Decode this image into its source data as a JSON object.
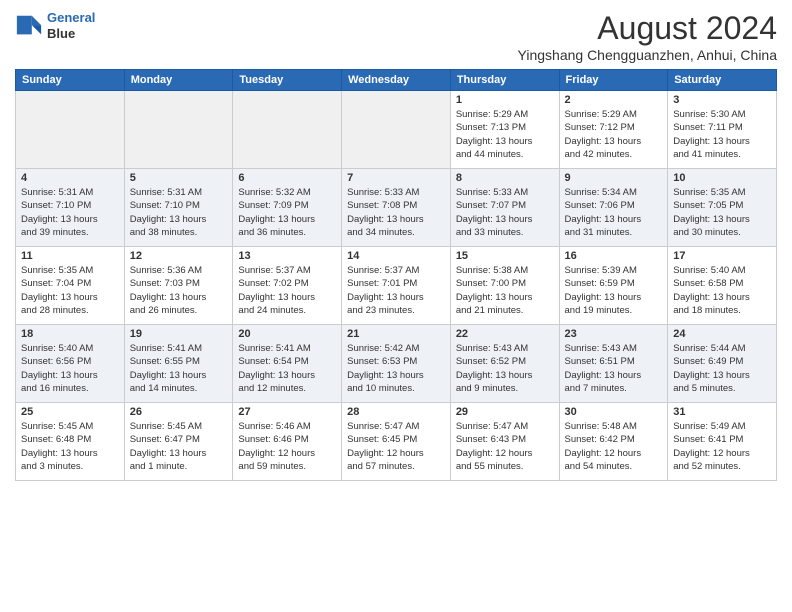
{
  "logo": {
    "line1": "General",
    "line2": "Blue"
  },
  "title": "August 2024",
  "subtitle": "Yingshang Chengguanzhen, Anhui, China",
  "weekdays": [
    "Sunday",
    "Monday",
    "Tuesday",
    "Wednesday",
    "Thursday",
    "Friday",
    "Saturday"
  ],
  "rows": [
    [
      {
        "day": "",
        "info": ""
      },
      {
        "day": "",
        "info": ""
      },
      {
        "day": "",
        "info": ""
      },
      {
        "day": "",
        "info": ""
      },
      {
        "day": "1",
        "info": "Sunrise: 5:29 AM\nSunset: 7:13 PM\nDaylight: 13 hours\nand 44 minutes."
      },
      {
        "day": "2",
        "info": "Sunrise: 5:29 AM\nSunset: 7:12 PM\nDaylight: 13 hours\nand 42 minutes."
      },
      {
        "day": "3",
        "info": "Sunrise: 5:30 AM\nSunset: 7:11 PM\nDaylight: 13 hours\nand 41 minutes."
      }
    ],
    [
      {
        "day": "4",
        "info": "Sunrise: 5:31 AM\nSunset: 7:10 PM\nDaylight: 13 hours\nand 39 minutes."
      },
      {
        "day": "5",
        "info": "Sunrise: 5:31 AM\nSunset: 7:10 PM\nDaylight: 13 hours\nand 38 minutes."
      },
      {
        "day": "6",
        "info": "Sunrise: 5:32 AM\nSunset: 7:09 PM\nDaylight: 13 hours\nand 36 minutes."
      },
      {
        "day": "7",
        "info": "Sunrise: 5:33 AM\nSunset: 7:08 PM\nDaylight: 13 hours\nand 34 minutes."
      },
      {
        "day": "8",
        "info": "Sunrise: 5:33 AM\nSunset: 7:07 PM\nDaylight: 13 hours\nand 33 minutes."
      },
      {
        "day": "9",
        "info": "Sunrise: 5:34 AM\nSunset: 7:06 PM\nDaylight: 13 hours\nand 31 minutes."
      },
      {
        "day": "10",
        "info": "Sunrise: 5:35 AM\nSunset: 7:05 PM\nDaylight: 13 hours\nand 30 minutes."
      }
    ],
    [
      {
        "day": "11",
        "info": "Sunrise: 5:35 AM\nSunset: 7:04 PM\nDaylight: 13 hours\nand 28 minutes."
      },
      {
        "day": "12",
        "info": "Sunrise: 5:36 AM\nSunset: 7:03 PM\nDaylight: 13 hours\nand 26 minutes."
      },
      {
        "day": "13",
        "info": "Sunrise: 5:37 AM\nSunset: 7:02 PM\nDaylight: 13 hours\nand 24 minutes."
      },
      {
        "day": "14",
        "info": "Sunrise: 5:37 AM\nSunset: 7:01 PM\nDaylight: 13 hours\nand 23 minutes."
      },
      {
        "day": "15",
        "info": "Sunrise: 5:38 AM\nSunset: 7:00 PM\nDaylight: 13 hours\nand 21 minutes."
      },
      {
        "day": "16",
        "info": "Sunrise: 5:39 AM\nSunset: 6:59 PM\nDaylight: 13 hours\nand 19 minutes."
      },
      {
        "day": "17",
        "info": "Sunrise: 5:40 AM\nSunset: 6:58 PM\nDaylight: 13 hours\nand 18 minutes."
      }
    ],
    [
      {
        "day": "18",
        "info": "Sunrise: 5:40 AM\nSunset: 6:56 PM\nDaylight: 13 hours\nand 16 minutes."
      },
      {
        "day": "19",
        "info": "Sunrise: 5:41 AM\nSunset: 6:55 PM\nDaylight: 13 hours\nand 14 minutes."
      },
      {
        "day": "20",
        "info": "Sunrise: 5:41 AM\nSunset: 6:54 PM\nDaylight: 13 hours\nand 12 minutes."
      },
      {
        "day": "21",
        "info": "Sunrise: 5:42 AM\nSunset: 6:53 PM\nDaylight: 13 hours\nand 10 minutes."
      },
      {
        "day": "22",
        "info": "Sunrise: 5:43 AM\nSunset: 6:52 PM\nDaylight: 13 hours\nand 9 minutes."
      },
      {
        "day": "23",
        "info": "Sunrise: 5:43 AM\nSunset: 6:51 PM\nDaylight: 13 hours\nand 7 minutes."
      },
      {
        "day": "24",
        "info": "Sunrise: 5:44 AM\nSunset: 6:49 PM\nDaylight: 13 hours\nand 5 minutes."
      }
    ],
    [
      {
        "day": "25",
        "info": "Sunrise: 5:45 AM\nSunset: 6:48 PM\nDaylight: 13 hours\nand 3 minutes."
      },
      {
        "day": "26",
        "info": "Sunrise: 5:45 AM\nSunset: 6:47 PM\nDaylight: 13 hours\nand 1 minute."
      },
      {
        "day": "27",
        "info": "Sunrise: 5:46 AM\nSunset: 6:46 PM\nDaylight: 12 hours\nand 59 minutes."
      },
      {
        "day": "28",
        "info": "Sunrise: 5:47 AM\nSunset: 6:45 PM\nDaylight: 12 hours\nand 57 minutes."
      },
      {
        "day": "29",
        "info": "Sunrise: 5:47 AM\nSunset: 6:43 PM\nDaylight: 12 hours\nand 55 minutes."
      },
      {
        "day": "30",
        "info": "Sunrise: 5:48 AM\nSunset: 6:42 PM\nDaylight: 12 hours\nand 54 minutes."
      },
      {
        "day": "31",
        "info": "Sunrise: 5:49 AM\nSunset: 6:41 PM\nDaylight: 12 hours\nand 52 minutes."
      }
    ]
  ]
}
